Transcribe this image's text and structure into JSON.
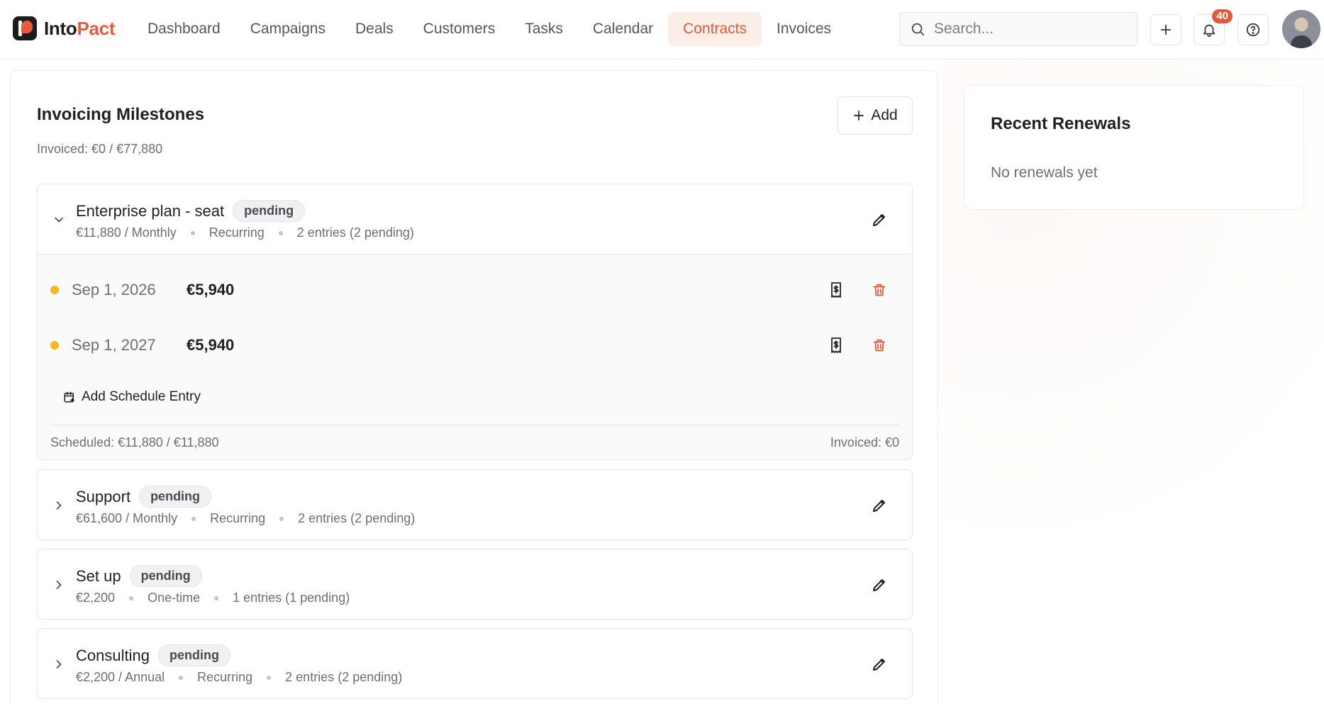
{
  "brand": {
    "part1": "Into",
    "part2": "Pact"
  },
  "nav": [
    {
      "label": "Dashboard",
      "active": false
    },
    {
      "label": "Campaigns",
      "active": false
    },
    {
      "label": "Deals",
      "active": false
    },
    {
      "label": "Customers",
      "active": false
    },
    {
      "label": "Tasks",
      "active": false
    },
    {
      "label": "Calendar",
      "active": false
    },
    {
      "label": "Contracts",
      "active": true
    },
    {
      "label": "Invoices",
      "active": false
    }
  ],
  "search": {
    "placeholder": "Search..."
  },
  "notifications": {
    "count": "40"
  },
  "colors": {
    "accent": "#e05a39",
    "pending_dot": "#f5b71d",
    "danger": "#e05a39"
  },
  "milestones": {
    "title": "Invoicing Milestones",
    "invoiced_summary": "Invoiced: €0 / €77,880",
    "add_label": "Add",
    "items": [
      {
        "name": "Enterprise plan - seat",
        "status": "pending",
        "amount": "€11,880 / Monthly",
        "kind": "Recurring",
        "entries": "2 entries (2 pending)",
        "expanded": true,
        "schedule": [
          {
            "date": "Sep 1, 2026",
            "amount": "€5,940"
          },
          {
            "date": "Sep 1, 2027",
            "amount": "€5,940"
          }
        ],
        "add_entry_label": "Add Schedule Entry",
        "scheduled": "Scheduled: €11,880 / €11,880",
        "invoiced": "Invoiced: €0"
      },
      {
        "name": "Support",
        "status": "pending",
        "amount": "€61,600 / Monthly",
        "kind": "Recurring",
        "entries": "2 entries (2 pending)",
        "expanded": false
      },
      {
        "name": "Set up",
        "status": "pending",
        "amount": "€2,200",
        "kind": "One-time",
        "entries": "1 entries (1 pending)",
        "expanded": false
      },
      {
        "name": "Consulting",
        "status": "pending",
        "amount": "€2,200 / Annual",
        "kind": "Recurring",
        "entries": "2 entries (2 pending)",
        "expanded": false
      }
    ]
  },
  "renewals": {
    "title": "Recent Renewals",
    "empty": "No renewals yet"
  }
}
